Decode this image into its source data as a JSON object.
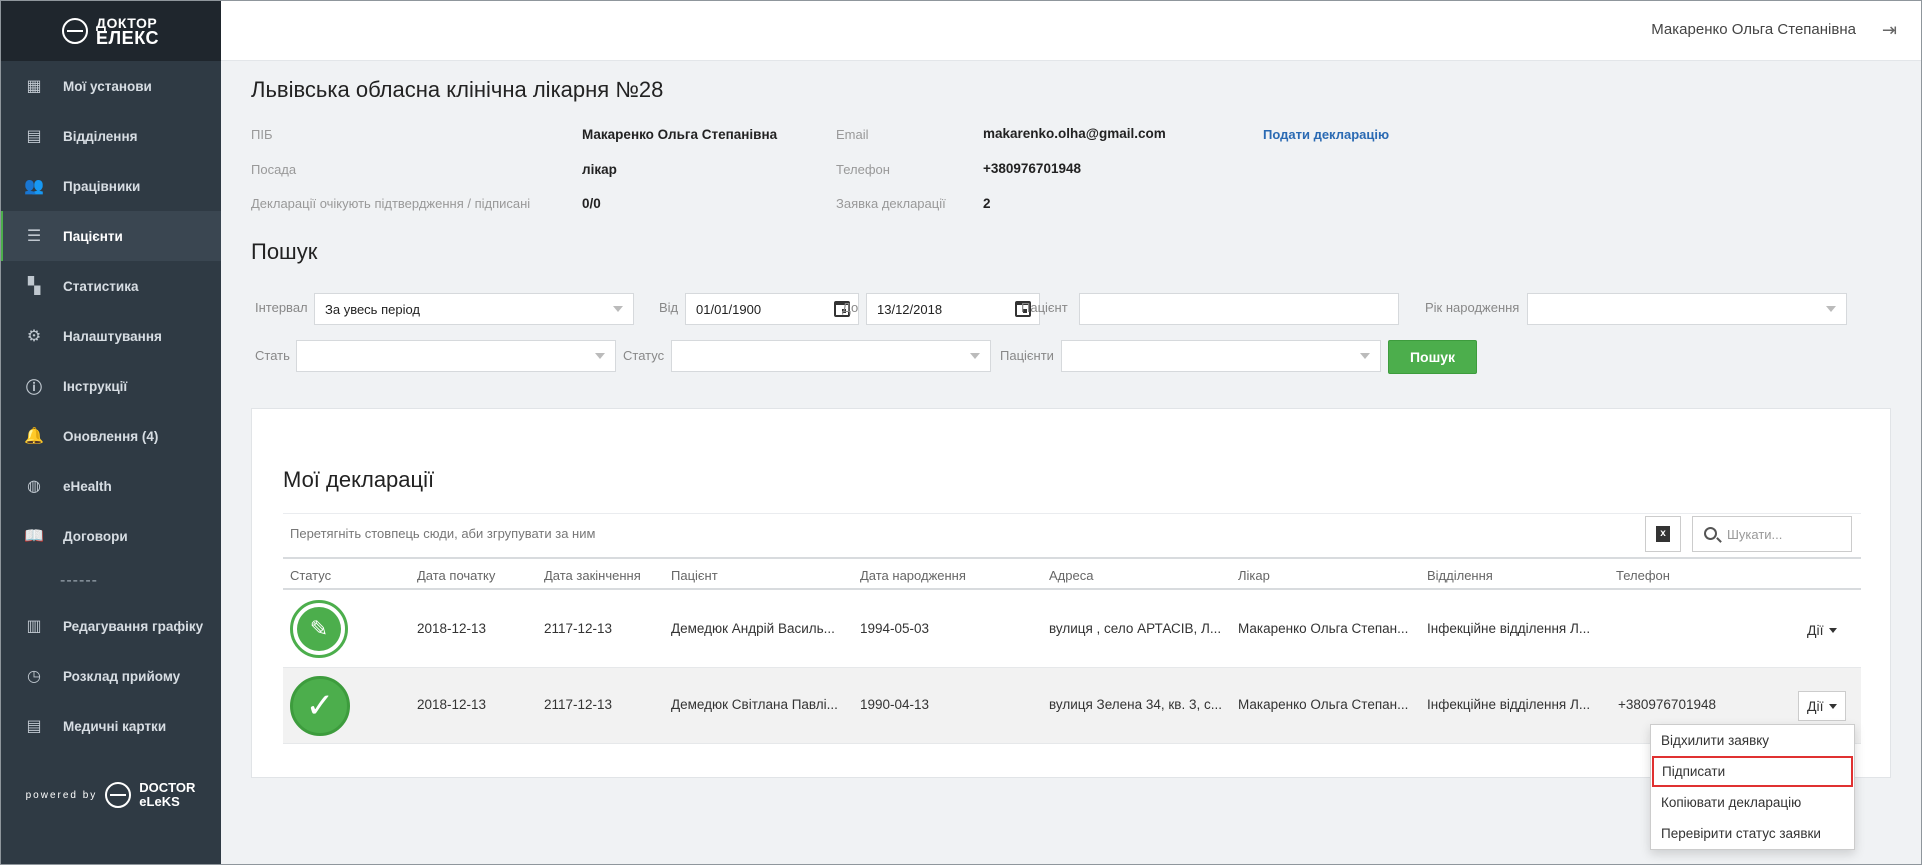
{
  "brand": {
    "logo_line1": "ДОКТОР",
    "logo_line2": "ЕЛЕКС",
    "powered": "powered by",
    "powered_line1": "DOCTOR",
    "powered_line2": "eLeKS"
  },
  "sidebar": {
    "items": [
      {
        "label": "Мої установи",
        "icon": "building-icon"
      },
      {
        "label": "Відділення",
        "icon": "department-icon"
      },
      {
        "label": "Працівники",
        "icon": "people-icon"
      },
      {
        "label": "Пацієнти",
        "icon": "list-icon",
        "active": true
      },
      {
        "label": "Статистика",
        "icon": "dashboard-icon"
      },
      {
        "label": "Налаштування",
        "icon": "gear-icon"
      },
      {
        "label": "Інструкції",
        "icon": "info-icon"
      },
      {
        "label": "Оновлення (4)",
        "icon": "bell-icon"
      },
      {
        "label": "eHealth",
        "icon": "globe-icon"
      },
      {
        "label": "Договори",
        "icon": "book-icon"
      }
    ],
    "separator": "------",
    "items2": [
      {
        "label": "Редагування графіку",
        "icon": "calendar-grid-icon"
      },
      {
        "label": "Розклад прийому",
        "icon": "clock-icon"
      },
      {
        "label": "Медичні картки",
        "icon": "cards-icon"
      }
    ]
  },
  "header": {
    "user_name": "Макаренко Ольга Степанівна"
  },
  "hospital": {
    "title": "Львівська обласна клінічна лікарня №28",
    "pib_label": "ПІБ",
    "pib_value": "Макаренко Ольга Степанівна",
    "position_label": "Посада",
    "position_value": "лікар",
    "decl_label": "Декларації очікують підтвердження / підписані",
    "decl_value": "0/0",
    "email_label": "Email",
    "email_value": "makarenko.olha@gmail.com",
    "phone_label": "Телефон",
    "phone_value": "+380976701948",
    "request_label": "Заявка декларації",
    "request_value": "2",
    "submit_link": "Подати декларацію"
  },
  "search": {
    "title": "Пошук",
    "interval_label": "Інтервал",
    "interval_value": "За увесь період",
    "from_label": "Від",
    "from_value": "01/01/1900",
    "to_label": "До",
    "to_value": "13/12/2018",
    "patient_label": "Пацієнт",
    "patient_value": "",
    "year_label": "Рік народження",
    "year_value": "",
    "sex_label": "Стать",
    "sex_value": "",
    "status_label": "Статус",
    "status_value": "",
    "patients_label": "Пацієнти",
    "patients_value": "",
    "button": "Пошук"
  },
  "declarations": {
    "title": "Мої декларації",
    "group_hint": "Перетягніть стовпець сюди, аби згрупувати за ним",
    "search_placeholder": "Шукати...",
    "columns": [
      "Статус",
      "Дата початку",
      "Дата закінчення",
      "Пацієнт",
      "Дата народження",
      "Адреса",
      "Лікар",
      "Відділення",
      "Телефон"
    ],
    "rows": [
      {
        "status": "pending",
        "start": "2018-12-13",
        "end": "2117-12-13",
        "patient": "Демедюк Андрій Василь...",
        "birth": "1994-05-03",
        "address": "вулиця , село АРТАСІВ, Л...",
        "doctor": "Макаренко Ольга Степан...",
        "department": "Інфекційне відділення Л...",
        "phone": "",
        "actions": "Дії"
      },
      {
        "status": "signed",
        "start": "2018-12-13",
        "end": "2117-12-13",
        "patient": "Демедюк Світлана Павлі...",
        "birth": "1990-04-13",
        "address": "вулиця Зелена 34, кв. 3, с...",
        "doctor": "Макаренко Ольга Степан...",
        "department": "Інфекційне відділення Л...",
        "phone": "+380976701948",
        "actions": "Дії"
      }
    ],
    "menu": [
      "Відхилити заявку",
      "Підписати",
      "Копіювати декларацію",
      "Перевірити статус заявки"
    ]
  },
  "colors": {
    "accent": "#4cae4c",
    "sidebar": "#2f3a44",
    "highlight": "#e03131",
    "link": "#2a6ab3"
  }
}
